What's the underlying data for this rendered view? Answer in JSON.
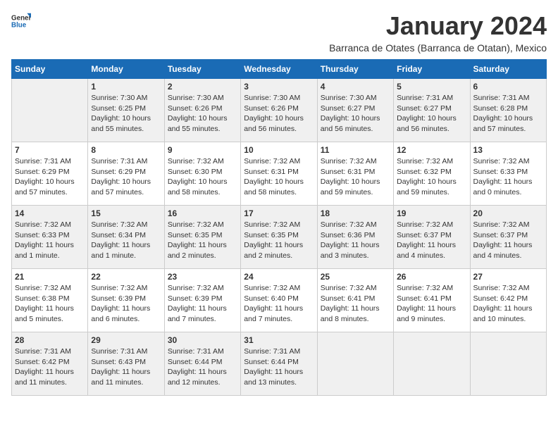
{
  "logo": {
    "general": "General",
    "blue": "Blue"
  },
  "header": {
    "title": "January 2024",
    "subtitle": "Barranca de Otates (Barranca de Otatan), Mexico"
  },
  "weekdays": [
    "Sunday",
    "Monday",
    "Tuesday",
    "Wednesday",
    "Thursday",
    "Friday",
    "Saturday"
  ],
  "weeks": [
    [
      {
        "day": "",
        "text": ""
      },
      {
        "day": "1",
        "text": "Sunrise: 7:30 AM\nSunset: 6:25 PM\nDaylight: 10 hours and 55 minutes."
      },
      {
        "day": "2",
        "text": "Sunrise: 7:30 AM\nSunset: 6:26 PM\nDaylight: 10 hours and 55 minutes."
      },
      {
        "day": "3",
        "text": "Sunrise: 7:30 AM\nSunset: 6:26 PM\nDaylight: 10 hours and 56 minutes."
      },
      {
        "day": "4",
        "text": "Sunrise: 7:30 AM\nSunset: 6:27 PM\nDaylight: 10 hours and 56 minutes."
      },
      {
        "day": "5",
        "text": "Sunrise: 7:31 AM\nSunset: 6:27 PM\nDaylight: 10 hours and 56 minutes."
      },
      {
        "day": "6",
        "text": "Sunrise: 7:31 AM\nSunset: 6:28 PM\nDaylight: 10 hours and 57 minutes."
      }
    ],
    [
      {
        "day": "7",
        "text": "Sunrise: 7:31 AM\nSunset: 6:29 PM\nDaylight: 10 hours and 57 minutes."
      },
      {
        "day": "8",
        "text": "Sunrise: 7:31 AM\nSunset: 6:29 PM\nDaylight: 10 hours and 57 minutes."
      },
      {
        "day": "9",
        "text": "Sunrise: 7:32 AM\nSunset: 6:30 PM\nDaylight: 10 hours and 58 minutes."
      },
      {
        "day": "10",
        "text": "Sunrise: 7:32 AM\nSunset: 6:31 PM\nDaylight: 10 hours and 58 minutes."
      },
      {
        "day": "11",
        "text": "Sunrise: 7:32 AM\nSunset: 6:31 PM\nDaylight: 10 hours and 59 minutes."
      },
      {
        "day": "12",
        "text": "Sunrise: 7:32 AM\nSunset: 6:32 PM\nDaylight: 10 hours and 59 minutes."
      },
      {
        "day": "13",
        "text": "Sunrise: 7:32 AM\nSunset: 6:33 PM\nDaylight: 11 hours and 0 minutes."
      }
    ],
    [
      {
        "day": "14",
        "text": "Sunrise: 7:32 AM\nSunset: 6:33 PM\nDaylight: 11 hours and 1 minute."
      },
      {
        "day": "15",
        "text": "Sunrise: 7:32 AM\nSunset: 6:34 PM\nDaylight: 11 hours and 1 minute."
      },
      {
        "day": "16",
        "text": "Sunrise: 7:32 AM\nSunset: 6:35 PM\nDaylight: 11 hours and 2 minutes."
      },
      {
        "day": "17",
        "text": "Sunrise: 7:32 AM\nSunset: 6:35 PM\nDaylight: 11 hours and 2 minutes."
      },
      {
        "day": "18",
        "text": "Sunrise: 7:32 AM\nSunset: 6:36 PM\nDaylight: 11 hours and 3 minutes."
      },
      {
        "day": "19",
        "text": "Sunrise: 7:32 AM\nSunset: 6:37 PM\nDaylight: 11 hours and 4 minutes."
      },
      {
        "day": "20",
        "text": "Sunrise: 7:32 AM\nSunset: 6:37 PM\nDaylight: 11 hours and 4 minutes."
      }
    ],
    [
      {
        "day": "21",
        "text": "Sunrise: 7:32 AM\nSunset: 6:38 PM\nDaylight: 11 hours and 5 minutes."
      },
      {
        "day": "22",
        "text": "Sunrise: 7:32 AM\nSunset: 6:39 PM\nDaylight: 11 hours and 6 minutes."
      },
      {
        "day": "23",
        "text": "Sunrise: 7:32 AM\nSunset: 6:39 PM\nDaylight: 11 hours and 7 minutes."
      },
      {
        "day": "24",
        "text": "Sunrise: 7:32 AM\nSunset: 6:40 PM\nDaylight: 11 hours and 7 minutes."
      },
      {
        "day": "25",
        "text": "Sunrise: 7:32 AM\nSunset: 6:41 PM\nDaylight: 11 hours and 8 minutes."
      },
      {
        "day": "26",
        "text": "Sunrise: 7:32 AM\nSunset: 6:41 PM\nDaylight: 11 hours and 9 minutes."
      },
      {
        "day": "27",
        "text": "Sunrise: 7:32 AM\nSunset: 6:42 PM\nDaylight: 11 hours and 10 minutes."
      }
    ],
    [
      {
        "day": "28",
        "text": "Sunrise: 7:31 AM\nSunset: 6:42 PM\nDaylight: 11 hours and 11 minutes."
      },
      {
        "day": "29",
        "text": "Sunrise: 7:31 AM\nSunset: 6:43 PM\nDaylight: 11 hours and 11 minutes."
      },
      {
        "day": "30",
        "text": "Sunrise: 7:31 AM\nSunset: 6:44 PM\nDaylight: 11 hours and 12 minutes."
      },
      {
        "day": "31",
        "text": "Sunrise: 7:31 AM\nSunset: 6:44 PM\nDaylight: 11 hours and 13 minutes."
      },
      {
        "day": "",
        "text": ""
      },
      {
        "day": "",
        "text": ""
      },
      {
        "day": "",
        "text": ""
      }
    ]
  ]
}
